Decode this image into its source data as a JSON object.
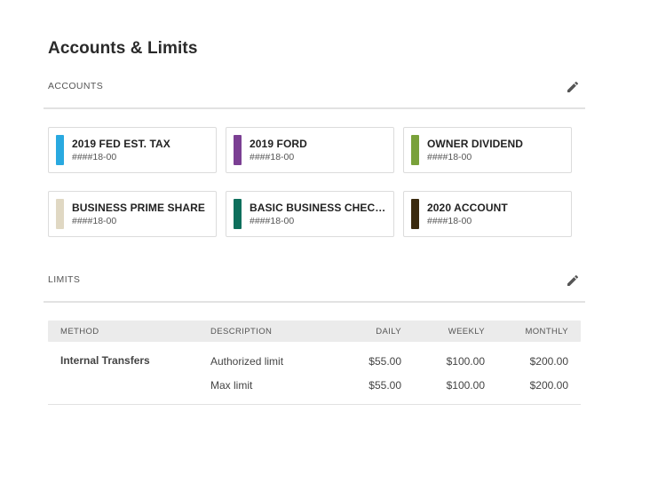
{
  "page": {
    "title": "Accounts & Limits"
  },
  "accounts": {
    "label": "ACCOUNTS",
    "items": [
      {
        "name": "2019 FED EST. TAX",
        "number": "####18-00",
        "color": "#29a9e0"
      },
      {
        "name": "2019 FORD",
        "number": "####18-00",
        "color": "#7b3f93"
      },
      {
        "name": "OWNER DIVIDEND",
        "number": "####18-00",
        "color": "#79a13a"
      },
      {
        "name": "BUSINESS PRIME SHARE",
        "number": "####18-00",
        "color": "#e0d8c3"
      },
      {
        "name": "BASIC BUSINESS CHECKI...",
        "number": "####18-00",
        "color": "#0e6f5c"
      },
      {
        "name": "2020 ACCOUNT",
        "number": "####18-00",
        "color": "#3a2a0e"
      }
    ]
  },
  "limits": {
    "label": "LIMITS",
    "headers": {
      "method": "METHOD",
      "description": "DESCRIPTION",
      "daily": "DAILY",
      "weekly": "WEEKLY",
      "monthly": "MONTHLY"
    },
    "rows": [
      {
        "method": "Internal Transfers",
        "description": "Authorized limit",
        "daily": "$55.00",
        "weekly": "$100.00",
        "monthly": "$200.00"
      },
      {
        "method": "",
        "description": "Max limit",
        "daily": "$55.00",
        "weekly": "$100.00",
        "monthly": "$200.00"
      }
    ]
  },
  "icons": {
    "edit": "pencil-icon"
  }
}
